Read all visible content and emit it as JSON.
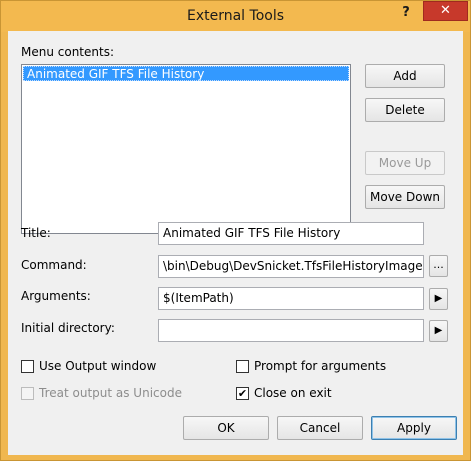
{
  "window": {
    "title": "External Tools",
    "help_glyph": "?",
    "close_glyph": "✕"
  },
  "menu_contents": {
    "label": "Menu contents:",
    "items": [
      {
        "label": "Animated GIF TFS File History",
        "selected": true
      }
    ]
  },
  "side_buttons": {
    "add": "Add",
    "delete": "Delete",
    "move_up": "Move Up",
    "move_down": "Move Down"
  },
  "form": {
    "title_label": "Title:",
    "title_value": "Animated GIF TFS File History",
    "command_label": "Command:",
    "command_value": "\\bin\\Debug\\DevSnicket.TfsFileHistoryImage.exe",
    "command_browse": "...",
    "arguments_label": "Arguments:",
    "arguments_value": "$(ItemPath)",
    "arguments_arrow": "▶",
    "initial_dir_label": "Initial directory:",
    "initial_dir_value": "",
    "initial_dir_arrow": "▶"
  },
  "options": {
    "use_output_window": {
      "label": "Use Output window",
      "checked": false,
      "check_glyph": ""
    },
    "treat_unicode": {
      "label": "Treat output as Unicode",
      "checked": false,
      "disabled": true,
      "check_glyph": ""
    },
    "prompt_args": {
      "label": "Prompt for arguments",
      "checked": false,
      "check_glyph": ""
    },
    "close_on_exit": {
      "label": "Close on exit",
      "checked": true,
      "check_glyph": "✔"
    }
  },
  "footer": {
    "ok": "OK",
    "cancel": "Cancel",
    "apply": "Apply"
  }
}
